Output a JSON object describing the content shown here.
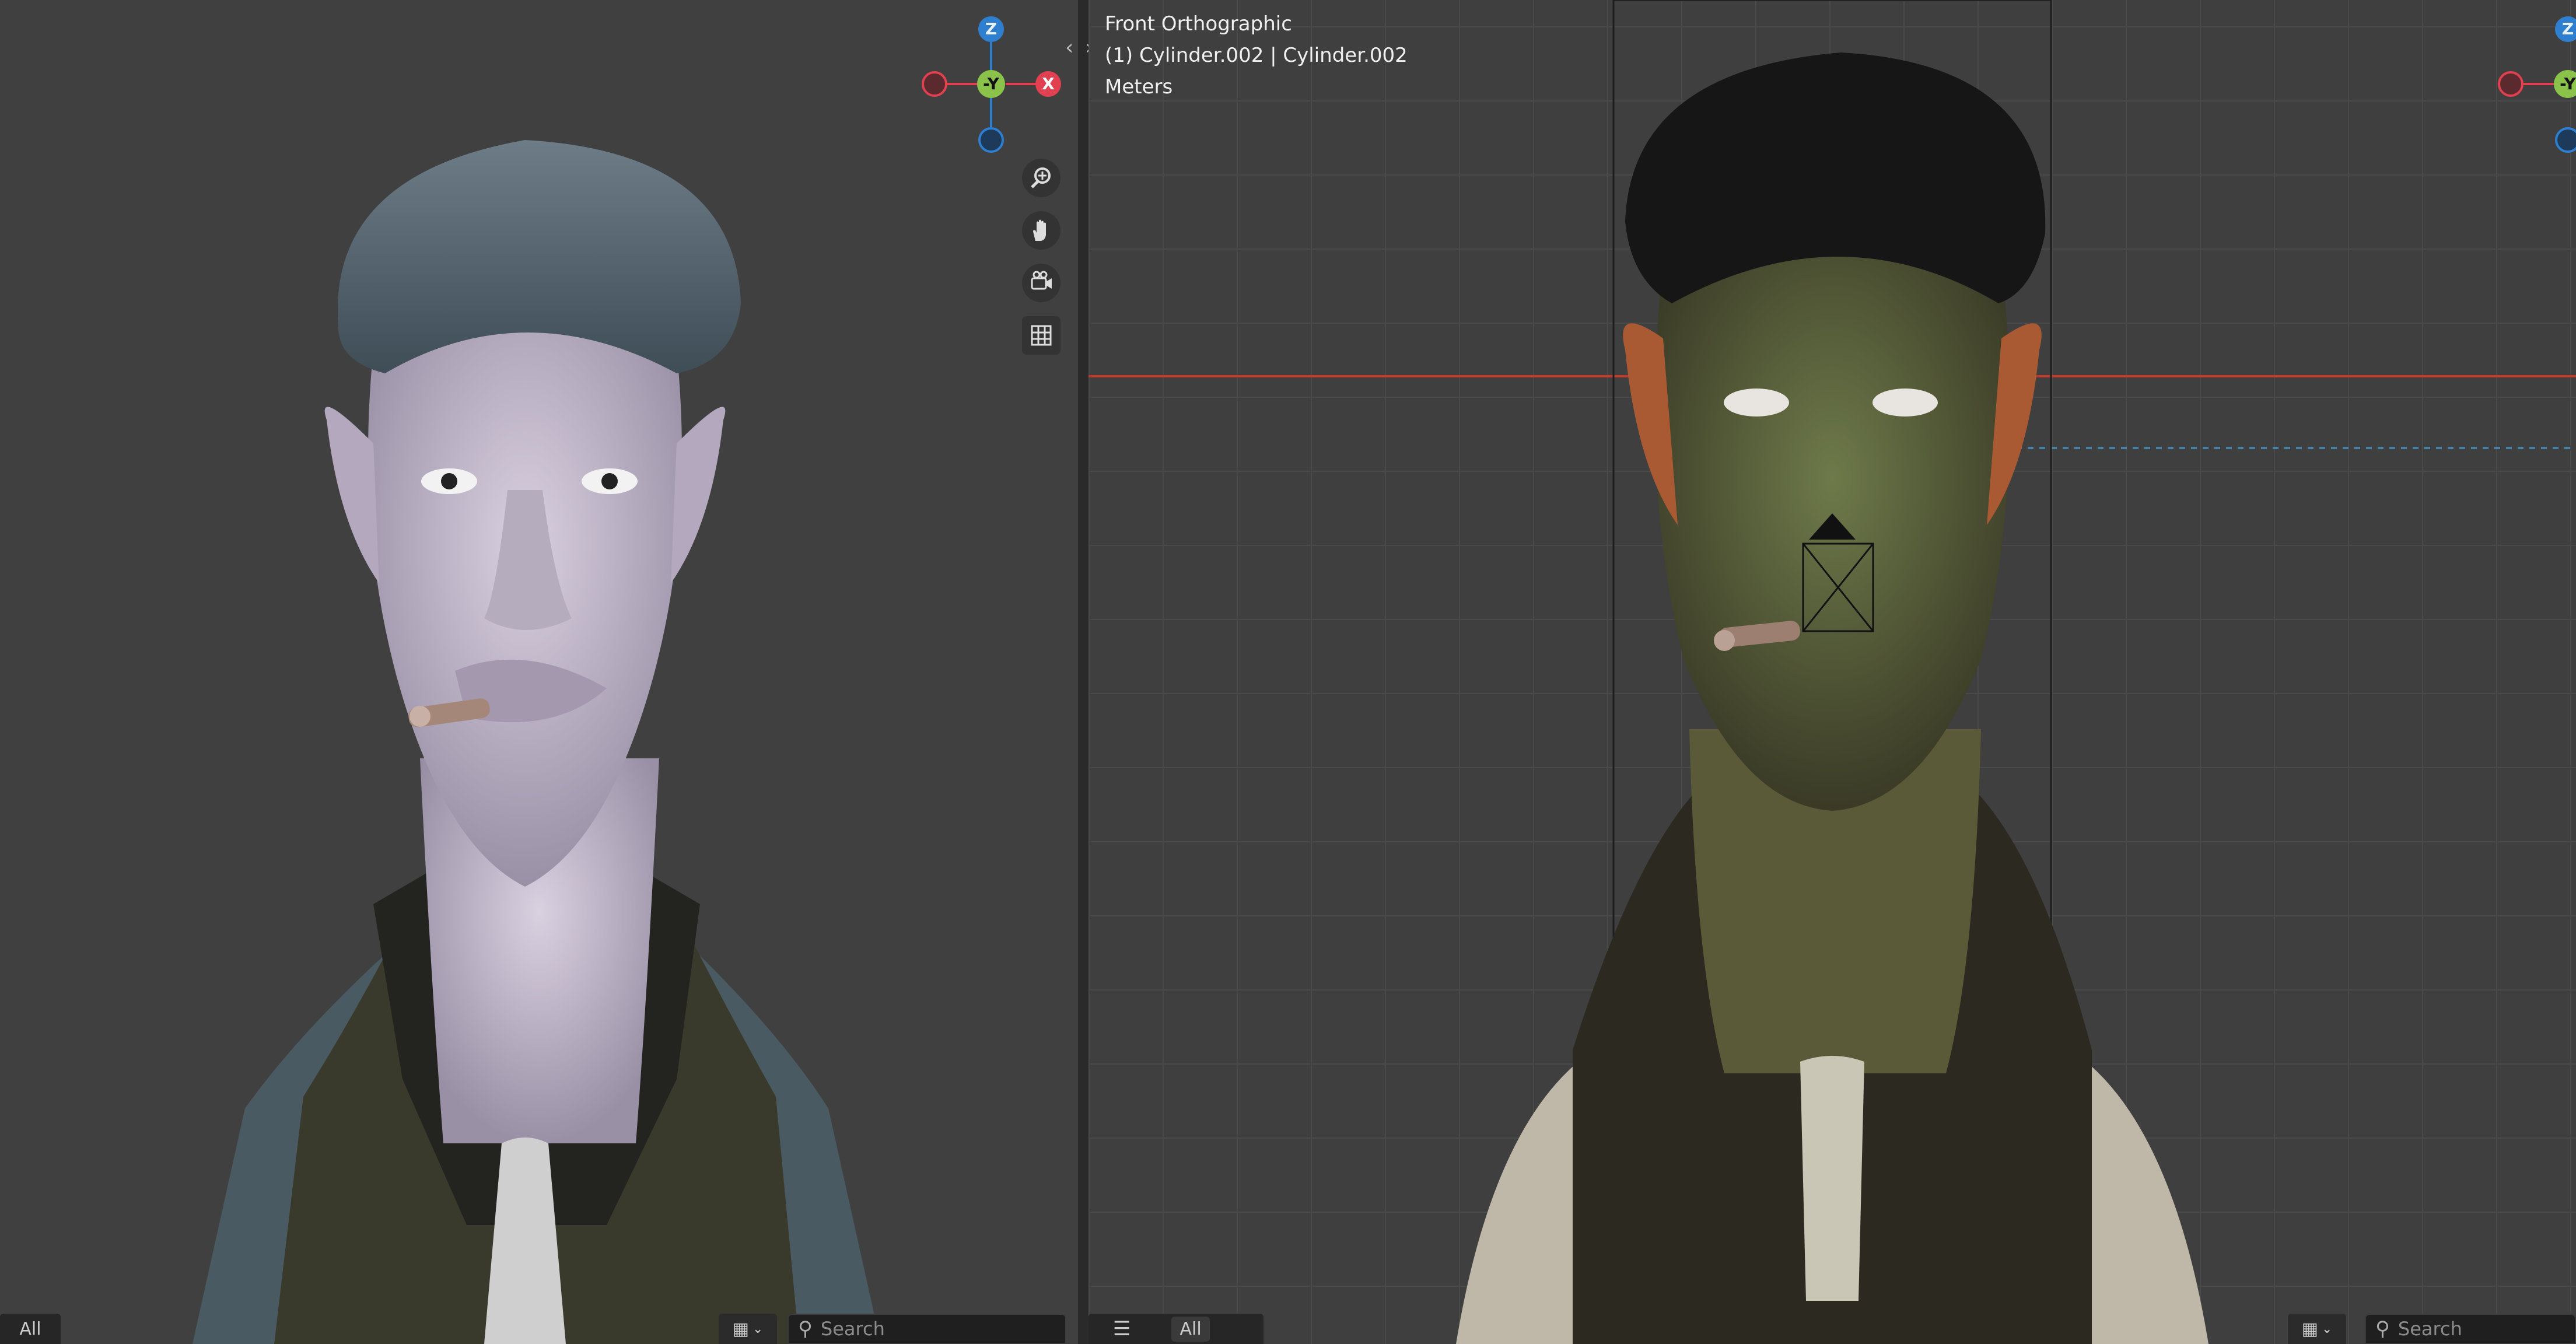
{
  "viewport_right": {
    "view_name": "Front Orthographic",
    "object_info": "(1) Cylinder.002 | Cylinder.002",
    "units": "Meters"
  },
  "gizmo": {
    "z_label": "Z",
    "x_label": "X",
    "neg_y_label": "-Y"
  },
  "colors": {
    "axis_x": "#e0404f",
    "axis_y": "#8bc34a",
    "axis_z": "#2f7fd0",
    "x_axis_line": "#c0392b"
  },
  "bottom_left": {
    "all_label": "All",
    "search_placeholder": "Search"
  },
  "bottom_right": {
    "all_label": "All",
    "search_placeholder": "Search"
  },
  "icons": {
    "zoom": "zoom-icon",
    "pan": "hand-icon",
    "camera": "camera-icon",
    "grid": "grid-icon"
  }
}
